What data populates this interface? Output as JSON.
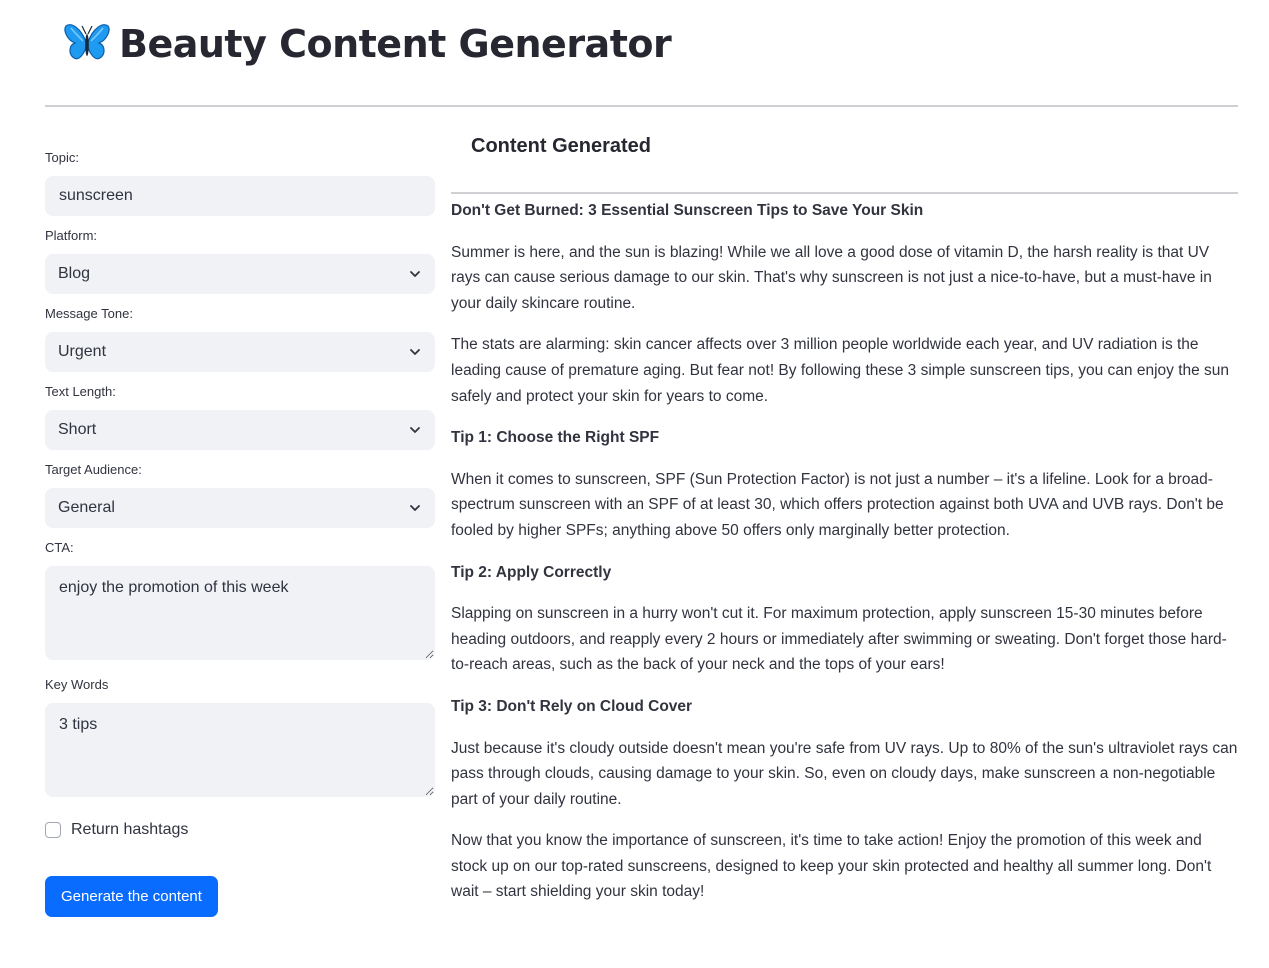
{
  "app": {
    "title": "Beauty Content Generator",
    "logo_icon": "butterfly-icon"
  },
  "form": {
    "topic": {
      "label": "Topic:",
      "value": "sunscreen"
    },
    "platform": {
      "label": "Platform:",
      "value": "Blog"
    },
    "tone": {
      "label": "Message Tone:",
      "value": "Urgent"
    },
    "length": {
      "label": "Text Length:",
      "value": "Short"
    },
    "audience": {
      "label": "Target Audience:",
      "value": "General"
    },
    "cta": {
      "label": "CTA:",
      "value": "enjoy the promotion of this week"
    },
    "keywords": {
      "label": "Key Words",
      "value": "3 tips"
    },
    "hashtags": {
      "label": "Return hashtags",
      "checked": false
    },
    "generate_label": "Generate the content"
  },
  "output": {
    "heading": "Content Generated",
    "title": "Don't Get Burned: 3 Essential Sunscreen Tips to Save Your Skin",
    "intro_1": "Summer is here, and the sun is blazing! While we all love a good dose of vitamin D, the harsh reality is that UV rays can cause serious damage to our skin. That's why sunscreen is not just a nice-to-have, but a must-have in your daily skincare routine.",
    "intro_2": "The stats are alarming: skin cancer affects over 3 million people worldwide each year, and UV radiation is the leading cause of premature aging. But fear not! By following these 3 simple sunscreen tips, you can enjoy the sun safely and protect your skin for years to come.",
    "tip1_title": "Tip 1: Choose the Right SPF",
    "tip1_body": "When it comes to sunscreen, SPF (Sun Protection Factor) is not just a number – it's a lifeline. Look for a broad-spectrum sunscreen with an SPF of at least 30, which offers protection against both UVA and UVB rays. Don't be fooled by higher SPFs; anything above 50 offers only marginally better protection.",
    "tip2_title": "Tip 2: Apply Correctly",
    "tip2_body": "Slapping on sunscreen in a hurry won't cut it. For maximum protection, apply sunscreen 15-30 minutes before heading outdoors, and reapply every 2 hours or immediately after swimming or sweating. Don't forget those hard-to-reach areas, such as the back of your neck and the tops of your ears!",
    "tip3_title": "Tip 3: Don't Rely on Cloud Cover",
    "tip3_body": "Just because it's cloudy outside doesn't mean you're safe from UV rays. Up to 80% of the sun's ultraviolet rays can pass through clouds, causing damage to your skin. So, even on cloudy days, make sunscreen a non-negotiable part of your daily routine.",
    "closing": "Now that you know the importance of sunscreen, it's time to take action! Enjoy the promotion of this week and stock up on our top-rated sunscreens, designed to keep your skin protected and healthy all summer long. Don't wait – start shielding your skin today!"
  },
  "colors": {
    "accent": "#0a6cff",
    "input_bg": "#f0f2f6",
    "text": "#31333f",
    "logo_blue": "#1e9bf0"
  }
}
